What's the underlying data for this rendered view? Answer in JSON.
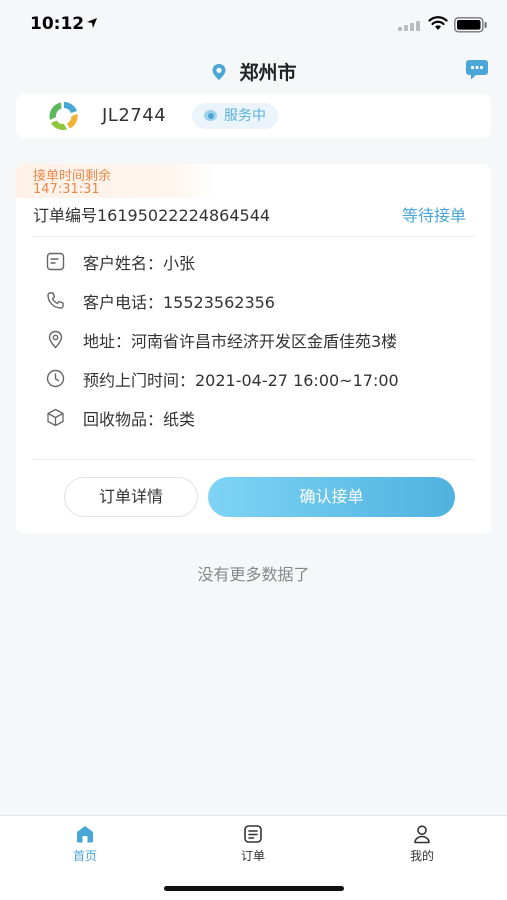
{
  "status_bar": {
    "time": "10:12"
  },
  "header": {
    "city": "郑州市",
    "icons": [
      "location-pin-icon",
      "message-bubble-icon"
    ]
  },
  "user": {
    "id": "JL2744",
    "status": "服务中"
  },
  "order": {
    "remaining_label": "接单时间剩余",
    "remaining_time": "147:31:31",
    "order_number": "订单编号16195022224864544",
    "status": "等待接单",
    "info": [
      {
        "icon": "note-icon",
        "text": "客户姓名：小张"
      },
      {
        "icon": "phone-icon",
        "text": "客户电话：15523562356"
      },
      {
        "icon": "location-icon",
        "text": "地址：河南省许昌市经济开发区金盾佳苑3楼"
      },
      {
        "icon": "clock-icon",
        "text": "预约上门时间：2021-04-27 16:00~17:00"
      },
      {
        "icon": "box-icon",
        "text": "回收物品：纸类"
      }
    ],
    "detail_button": "订单详情",
    "confirm_button": "确认接单"
  },
  "list_footer": "没有更多数据了",
  "tabs": [
    {
      "label": "首页",
      "icon": "home-icon",
      "active": true
    },
    {
      "label": "订单",
      "icon": "order-list-icon",
      "active": false
    },
    {
      "label": "我的",
      "icon": "user-icon",
      "active": false
    }
  ],
  "colors": {
    "accent": "#4aa6d6",
    "timer": "#e8894a",
    "background": "#f5f7f9"
  }
}
